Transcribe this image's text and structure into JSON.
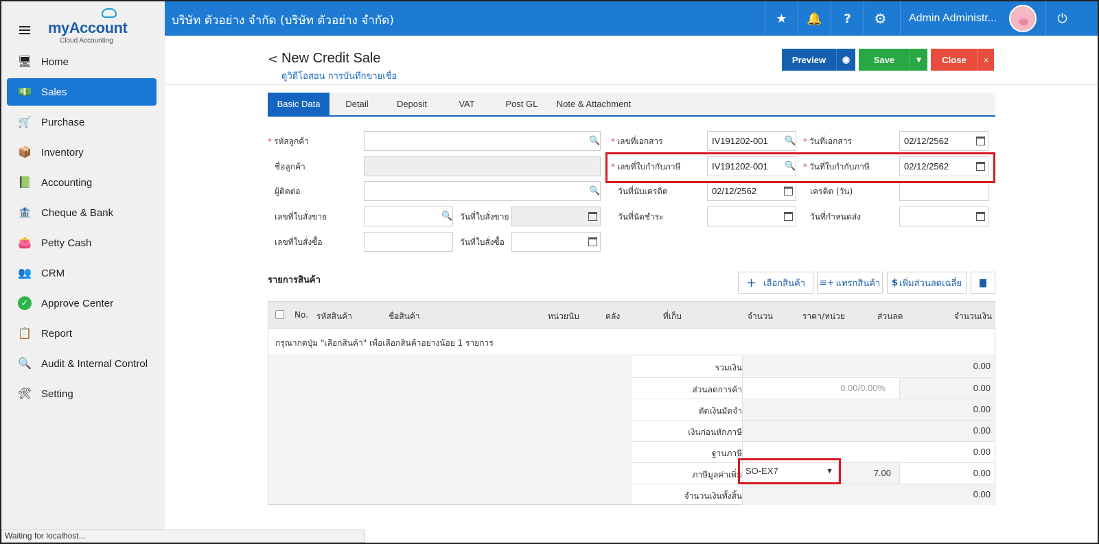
{
  "topbar": {
    "company": "บริษัท ตัวอย่าง จำกัด (บริษัท ตัวอย่าง จำกัด)",
    "user": "Admin Administr...",
    "icons": [
      "star-icon",
      "bell-icon",
      "help-icon",
      "gear-icon",
      "power-icon"
    ]
  },
  "logo": {
    "brand": "myAccount",
    "tagline": "Cloud Accounting"
  },
  "sidebar": {
    "items": [
      {
        "label": "Home",
        "icon": "home-icon"
      },
      {
        "label": "Sales",
        "icon": "sales-icon"
      },
      {
        "label": "Purchase",
        "icon": "cart-icon"
      },
      {
        "label": "Inventory",
        "icon": "box-icon"
      },
      {
        "label": "Accounting",
        "icon": "book-icon"
      },
      {
        "label": "Cheque & Bank",
        "icon": "bank-icon"
      },
      {
        "label": "Petty Cash",
        "icon": "wallet-icon"
      },
      {
        "label": "CRM",
        "icon": "people-icon"
      },
      {
        "label": "Approve Center",
        "icon": "check-icon"
      },
      {
        "label": "Report",
        "icon": "report-icon"
      },
      {
        "label": "Audit & Internal Control",
        "icon": "audit-icon"
      },
      {
        "label": "Setting",
        "icon": "tools-icon"
      }
    ],
    "active": "Sales"
  },
  "page": {
    "title": "New Credit Sale",
    "subtitle": "ดูวิดีโอสอน การบันทึกขายเชื่อ",
    "buttons": {
      "preview": "Preview",
      "save": "Save",
      "close": "Close"
    }
  },
  "tabs": [
    "Basic Data",
    "Detail",
    "Deposit",
    "VAT",
    "Post GL",
    "Note & Attachment"
  ],
  "form": {
    "customer_code": {
      "label": "รหัสลูกค้า",
      "value": ""
    },
    "customer_name": {
      "label": "ชื่อลูกค้า",
      "value": ""
    },
    "contact": {
      "label": "ผู้ติดต่อ",
      "value": ""
    },
    "so_no": {
      "label": "เลขที่ใบสั่งขาย",
      "value": ""
    },
    "so_date": {
      "label": "วันที่ใบสั่งขาย",
      "value": ""
    },
    "po_no": {
      "label": "เลขที่ใบสั่งซื้อ",
      "value": ""
    },
    "po_date": {
      "label": "วันที่ใบสั่งซื้อ",
      "value": ""
    },
    "doc_no": {
      "label": "เลขที่เอกสาร",
      "value": "IV191202-001"
    },
    "doc_date": {
      "label": "วันที่เอกสาร",
      "value": "02/12/2562"
    },
    "tax_inv_no": {
      "label": "เลขที่ใบกำกับภาษี",
      "value": "IV191202-001"
    },
    "tax_inv_date": {
      "label": "วันที่ใบกำกับภาษี",
      "value": "02/12/2562"
    },
    "credit_start": {
      "label": "วันที่นับเครดิต",
      "value": "02/12/2562"
    },
    "credit_days": {
      "label": "เครดิต (วัน)",
      "value": ""
    },
    "due_date": {
      "label": "วันที่นัดชำระ",
      "value": ""
    },
    "delivery_date": {
      "label": "วันที่กำหนดส่ง",
      "value": ""
    }
  },
  "items": {
    "title": "รายการสินค้า",
    "actions": {
      "select": "เลือกสินค้า",
      "insert": "แทรกสินค้า",
      "discount": "เพิ่มส่วนลดเฉลี่ย"
    },
    "headers": [
      "No.",
      "รหัสสินค้า",
      "ชื่อสินค้า",
      "หน่วยนับ",
      "คลัง",
      "ที่เก็บ",
      "จำนวน",
      "ราคา/หน่วย",
      "ส่วนลด",
      "จำนวนเงิน"
    ],
    "empty_message": "กรุณากดปุ่ม \"เลือกสินค้า\" เพื่อเลือกสินค้าอย่างน้อย 1 รายการ"
  },
  "summary": {
    "subtotal": {
      "label": "รวมเงิน",
      "value": "0.00"
    },
    "trade_discount": {
      "label": "ส่วนลดการค้า",
      "input": "0.00/0.00%",
      "value": "0.00"
    },
    "deposit": {
      "label": "ตัดเงินมัดจำ",
      "value": "0.00"
    },
    "before_tax": {
      "label": "เงินก่อนหักภาษี",
      "value": "0.00"
    },
    "tax_base": {
      "label": "ฐานภาษี",
      "value": "0.00"
    },
    "vat": {
      "label": "ภาษีมูลค่าเพิ่ม",
      "code": "SO-EX7",
      "rate": "7.00",
      "value": "0.00"
    },
    "total": {
      "label": "จำนวนเงินทั้งสิ้น",
      "value": "0.00"
    }
  },
  "status_bar": "Waiting for localhost..."
}
